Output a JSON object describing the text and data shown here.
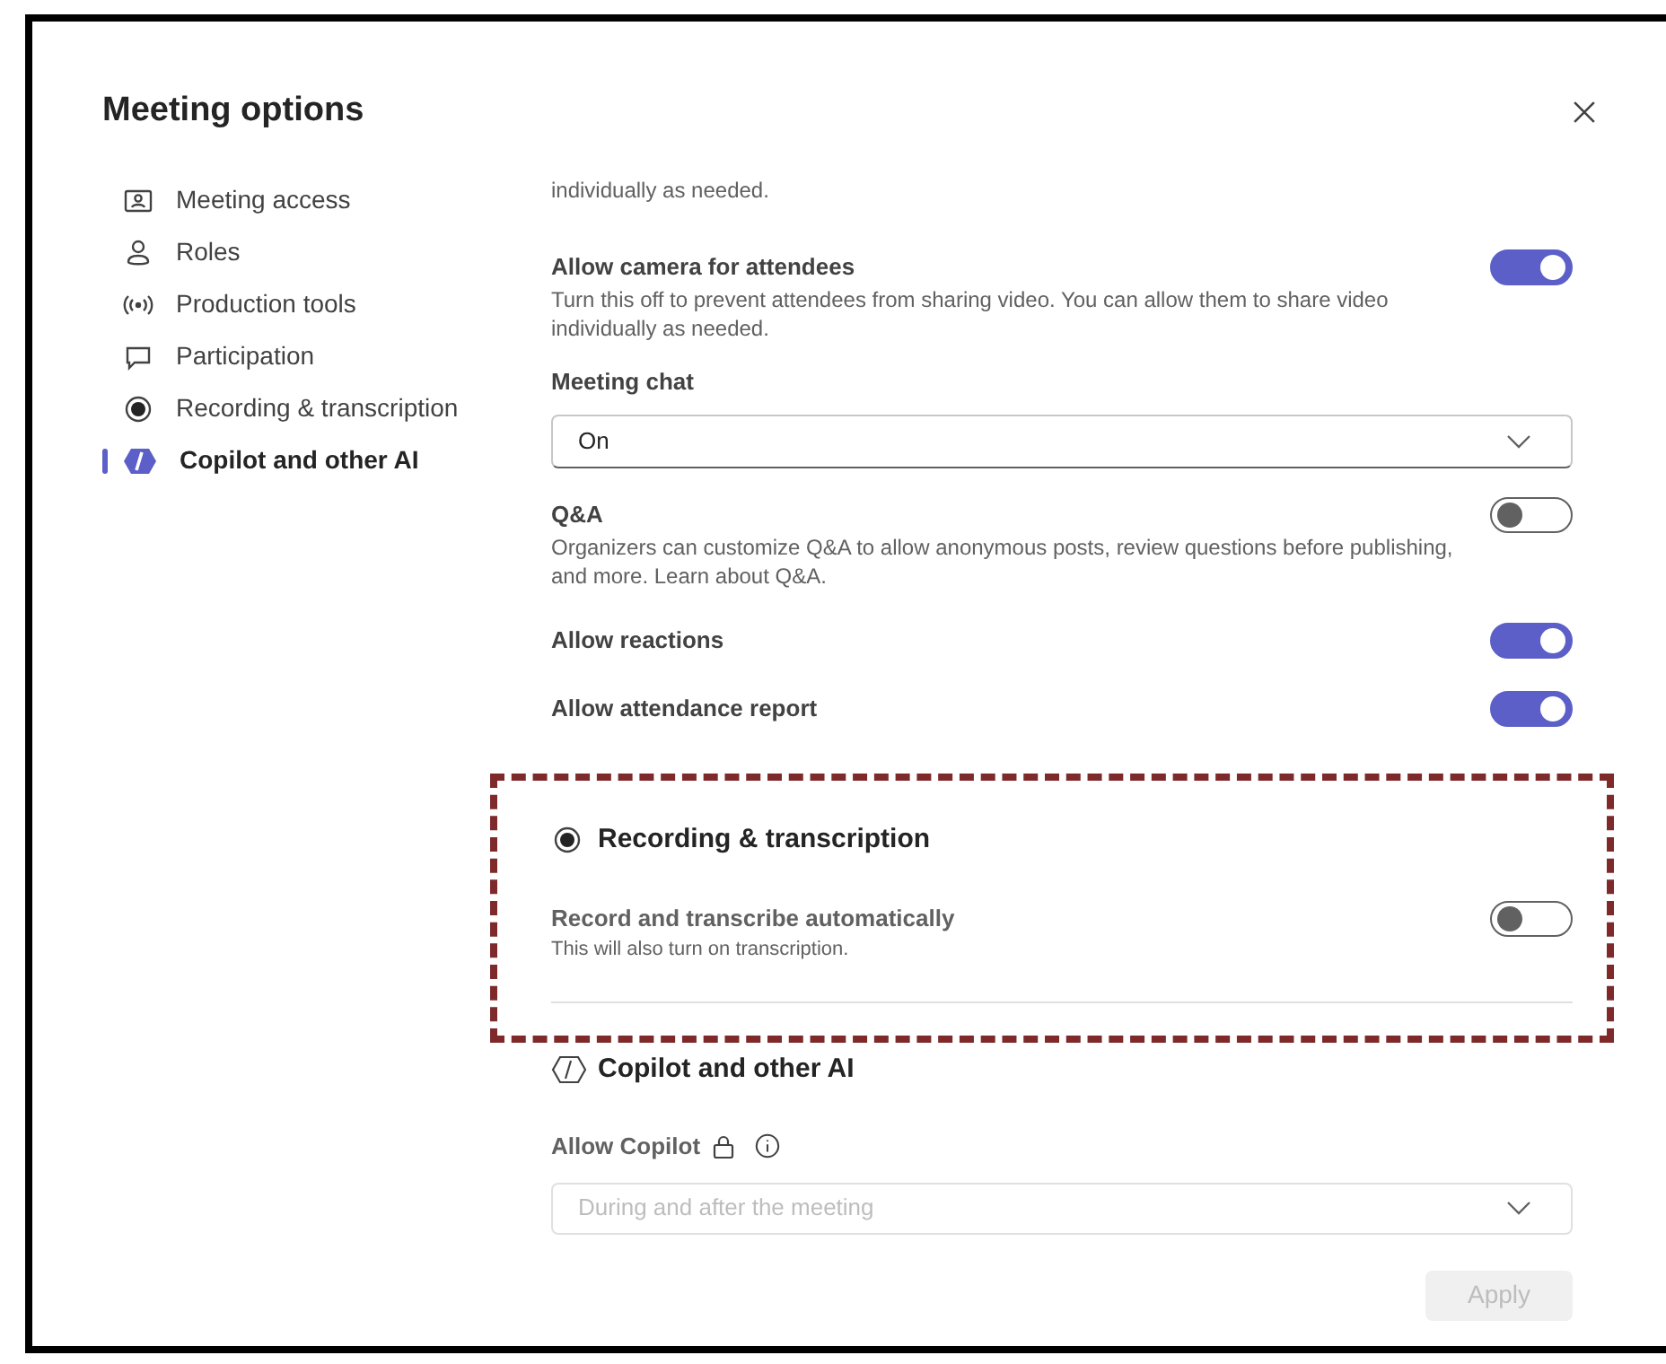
{
  "title": "Meeting options",
  "sidebar": {
    "items": [
      {
        "label": "Meeting access",
        "kind": "access",
        "selected": false
      },
      {
        "label": "Roles",
        "kind": "person",
        "selected": false
      },
      {
        "label": "Production tools",
        "kind": "broadcast",
        "selected": false
      },
      {
        "label": "Participation",
        "kind": "chat",
        "selected": false
      },
      {
        "label": "Recording & transcription",
        "kind": "record",
        "selected": false
      },
      {
        "label": "Copilot and other AI",
        "kind": "copilot",
        "selected": true
      }
    ]
  },
  "settings": [
    {
      "kind": "note",
      "description": "individually as needed."
    },
    {
      "kind": "toggle",
      "label": "Allow camera for attendees",
      "description": "Turn this off to prevent attendees from sharing video. You can allow them to share video individually as needed.",
      "on": true
    },
    {
      "kind": "dropdown",
      "label": "Meeting chat",
      "value": "On"
    },
    {
      "kind": "toggle",
      "label": "Q&A",
      "description": "Organizers can customize Q&A to allow anonymous posts, review questions before publishing, and more. Learn about Q&A.",
      "on": false
    },
    {
      "kind": "toggle",
      "label": "Allow reactions",
      "on": true
    },
    {
      "kind": "toggle",
      "label": "Allow attendance report",
      "on": true
    }
  ],
  "recording": {
    "title": "Recording & transcription",
    "label": "Record and transcribe automatically",
    "description": "This will also turn on transcription.",
    "on": false
  },
  "copilot": {
    "title": "Copilot and other AI",
    "label": "Allow Copilot",
    "value": "During and after the meeting",
    "disabled": true
  },
  "apply": {
    "label": "Apply",
    "disabled": true
  }
}
